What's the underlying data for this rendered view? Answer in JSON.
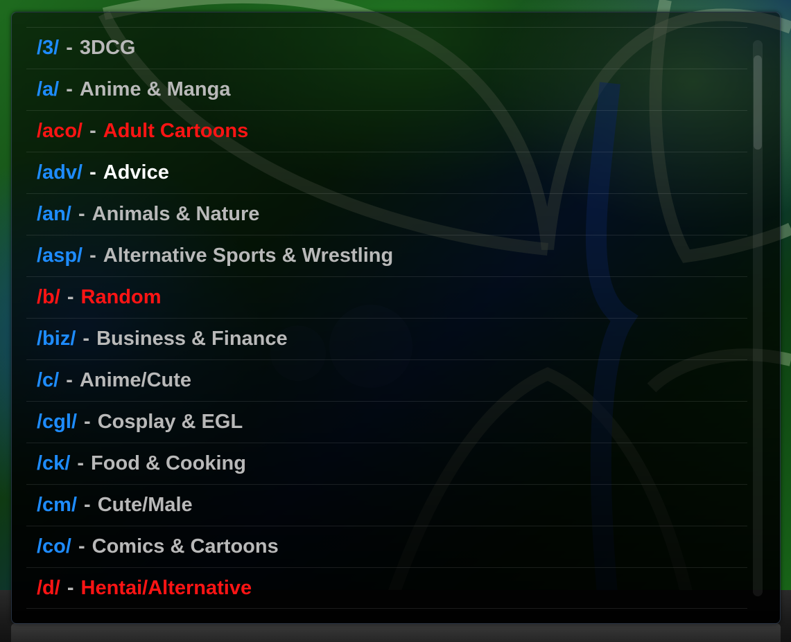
{
  "boards": [
    {
      "code": "/3/",
      "title": "3DCG",
      "nsfw": false,
      "focused": false
    },
    {
      "code": "/a/",
      "title": "Anime & Manga",
      "nsfw": false,
      "focused": false
    },
    {
      "code": "/aco/",
      "title": "Adult Cartoons",
      "nsfw": true,
      "focused": false
    },
    {
      "code": "/adv/",
      "title": "Advice",
      "nsfw": false,
      "focused": true
    },
    {
      "code": "/an/",
      "title": "Animals & Nature",
      "nsfw": false,
      "focused": false
    },
    {
      "code": "/asp/",
      "title": "Alternative Sports & Wrestling",
      "nsfw": false,
      "focused": false
    },
    {
      "code": "/b/",
      "title": "Random",
      "nsfw": true,
      "focused": false
    },
    {
      "code": "/biz/",
      "title": "Business & Finance",
      "nsfw": false,
      "focused": false
    },
    {
      "code": "/c/",
      "title": "Anime/Cute",
      "nsfw": false,
      "focused": false
    },
    {
      "code": "/cgl/",
      "title": "Cosplay & EGL",
      "nsfw": false,
      "focused": false
    },
    {
      "code": "/ck/",
      "title": "Food & Cooking",
      "nsfw": false,
      "focused": false
    },
    {
      "code": "/cm/",
      "title": "Cute/Male",
      "nsfw": false,
      "focused": false
    },
    {
      "code": "/co/",
      "title": "Comics & Cartoons",
      "nsfw": false,
      "focused": false
    },
    {
      "code": "/d/",
      "title": "Hentai/Alternative",
      "nsfw": true,
      "focused": false
    }
  ],
  "separator": "-",
  "colors": {
    "board_code": "#1e8cff",
    "board_title": "#b9b9b9",
    "nsfw": "#ff1414",
    "focused_title": "#ffffff"
  }
}
